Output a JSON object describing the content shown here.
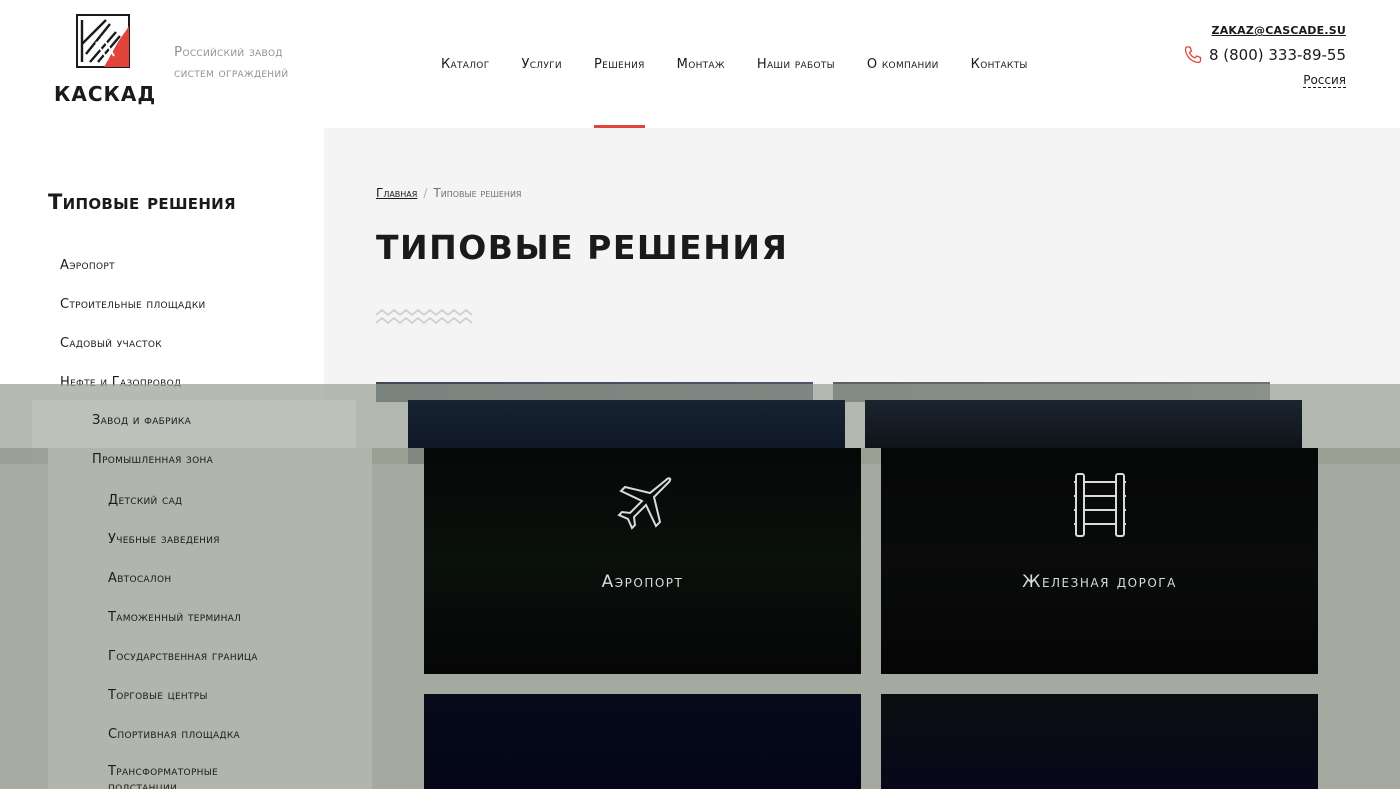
{
  "header": {
    "logo_text": "КАСКАД",
    "tagline_line1": "Российский завод",
    "tagline_line2": "систем ограждений",
    "email": "ZAKAZ@CASCADE.SU",
    "phone": "8 (800) 333-89-55",
    "region": "Россия",
    "accent_color": "#e0443a",
    "nav": [
      {
        "label": "Каталог"
      },
      {
        "label": "Услуги"
      },
      {
        "label": "Решения",
        "active": true
      },
      {
        "label": "Монтаж"
      },
      {
        "label": "Наши работы"
      },
      {
        "label": "О компании"
      },
      {
        "label": "Контакты"
      }
    ]
  },
  "sidebar": {
    "title": "Типовые решения",
    "items": [
      "Аэропорт",
      "Строительные площадки",
      "Садовый участок",
      "Нефте и Газопровод"
    ],
    "overlay_items_a": "Завод и фабрика",
    "overlay_items_b": "Промышленная зона",
    "items_lower": [
      "Детский сад",
      "Учебные заведения",
      "Автосалон",
      "Таможенный терминал",
      "Государственная граница",
      "Торговые центры",
      "Спортивная площадка",
      "Трансформаторные подстанции"
    ]
  },
  "main": {
    "breadcrumb_home": "Главная",
    "breadcrumb_sep": "/",
    "breadcrumb_current": "Типовые решения",
    "title": "ТИПОВЫЕ РЕШЕНИЯ",
    "cards": [
      {
        "label": "Аэропорт",
        "icon": "airplane-icon"
      },
      {
        "label": "Железная дорога",
        "icon": "railway-icon"
      }
    ]
  }
}
